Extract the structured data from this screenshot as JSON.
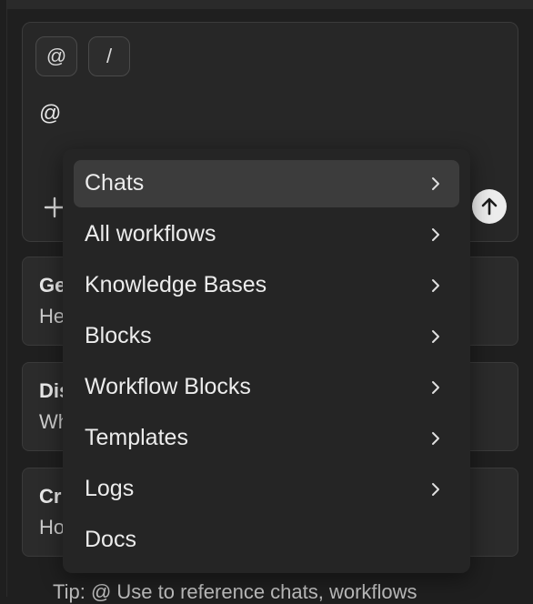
{
  "composer": {
    "chips": [
      "@",
      "/"
    ],
    "input_value": "@"
  },
  "cards": [
    {
      "title": "Ge",
      "subtitle": "He"
    },
    {
      "title": "Dis",
      "subtitle": "Wh"
    },
    {
      "title": "Cr",
      "subtitle": "Ho"
    }
  ],
  "tip": "Tip: @ Use to reference chats, workflows",
  "menu": {
    "items": [
      {
        "label": "Chats",
        "has_submenu": true,
        "active": true
      },
      {
        "label": "All workflows",
        "has_submenu": true
      },
      {
        "label": "Knowledge Bases",
        "has_submenu": true
      },
      {
        "label": "Blocks",
        "has_submenu": true
      },
      {
        "label": "Workflow Blocks",
        "has_submenu": true
      },
      {
        "label": "Templates",
        "has_submenu": true
      },
      {
        "label": "Logs",
        "has_submenu": true
      },
      {
        "label": "Docs",
        "has_submenu": false
      }
    ]
  },
  "colors": {
    "background": "#1f1f1f",
    "panel": "#272727",
    "menu": "#252525",
    "active_item": "#3c3c3c",
    "send_button": "#ececec"
  },
  "icons": {
    "plus": "plus-icon",
    "send": "arrow-up-icon",
    "chevron": "chevron-right-icon"
  }
}
